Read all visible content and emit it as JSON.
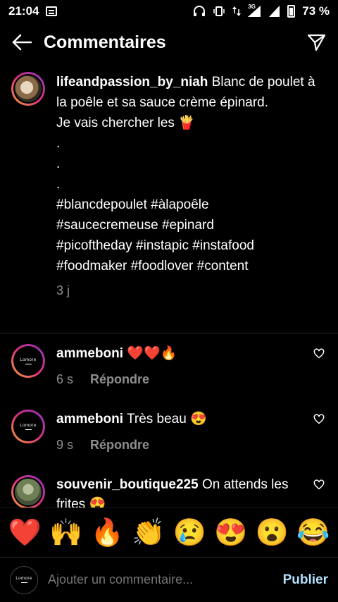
{
  "status": {
    "time": "21:04",
    "network": "3G",
    "battery": "73 %"
  },
  "header": {
    "title": "Commentaires"
  },
  "caption": {
    "username": "lifeandpassion_by_niah",
    "lines": [
      "Blanc de poulet à la poêle et sa sauce crème épinard.",
      "Je vais chercher les 🍟",
      ".",
      ".",
      ".",
      "#blancdepoulet #àlapoêle",
      "#saucecremeuse #epinard",
      "#picoftheday #instapic #instafood",
      "#foodmaker #foodlover #content"
    ],
    "time": "3 j"
  },
  "comments": [
    {
      "username": "ammeboni",
      "text": "❤️❤️🔥",
      "time": "6 s",
      "reply": "Répondre"
    },
    {
      "username": "ammeboni",
      "text": "Très beau 😍",
      "time": "9 s",
      "reply": "Répondre"
    },
    {
      "username": "souvenir_boutique225",
      "text": "On attends les frites 😍",
      "time": "",
      "reply": ""
    }
  ],
  "emojis": [
    "❤️",
    "🙌",
    "🔥",
    "👏",
    "😢",
    "😍",
    "😮",
    "😂"
  ],
  "input": {
    "placeholder": "Ajouter un commentaire...",
    "publish": "Publier"
  },
  "logo_text": "Lomore"
}
